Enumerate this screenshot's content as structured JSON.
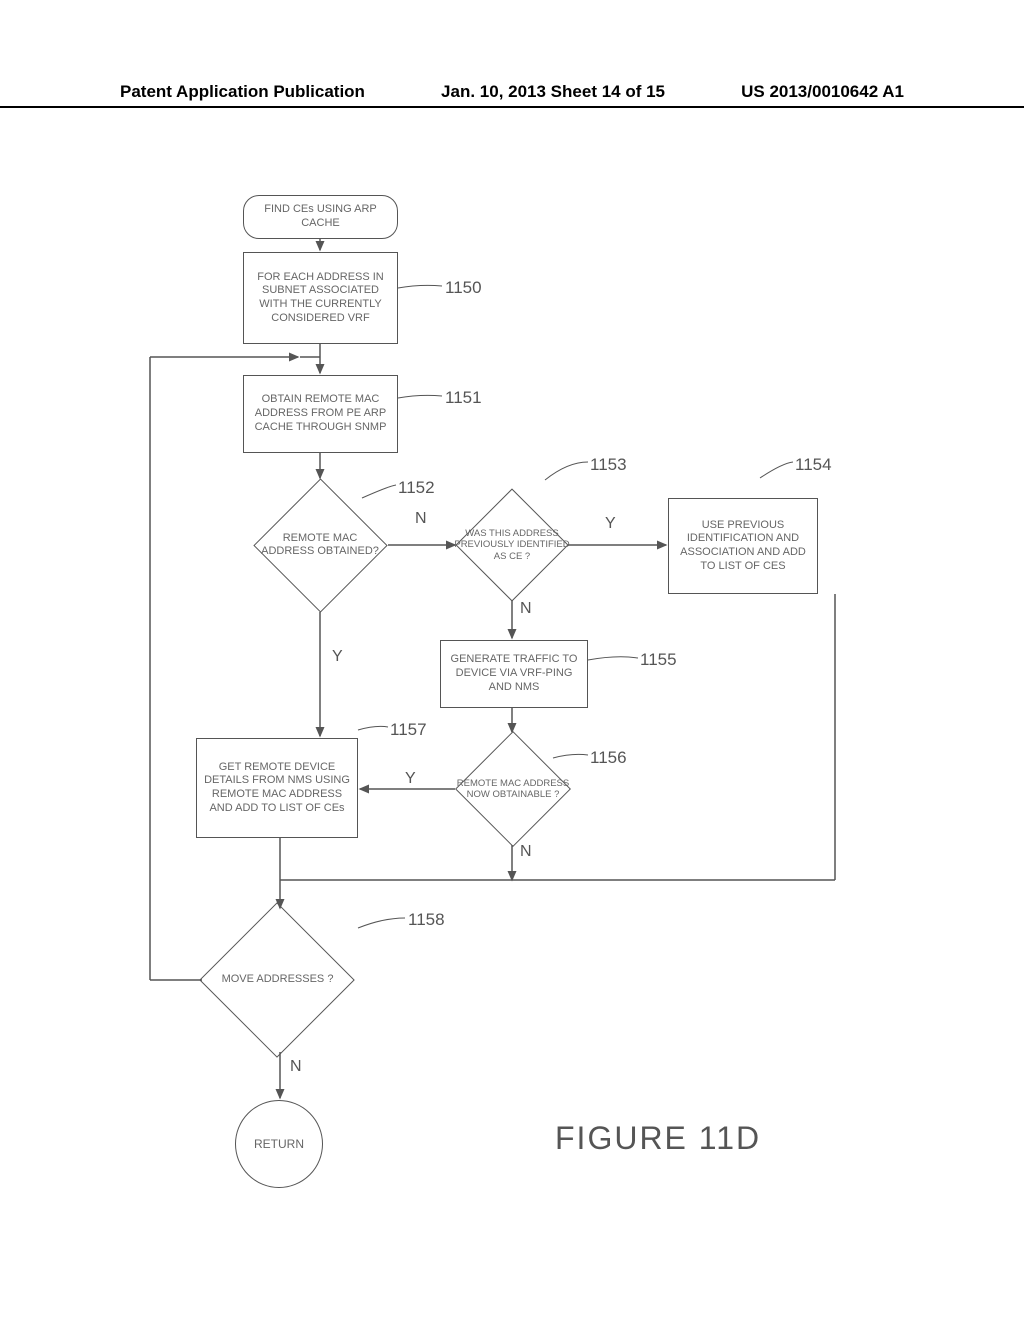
{
  "header": {
    "left": "Patent Application Publication",
    "center": "Jan. 10, 2013  Sheet 14 of 15",
    "right": "US 2013/0010642 A1"
  },
  "start": "FIND CEs USING ARP CACHE",
  "boxes": {
    "b1150": "FOR EACH ADDRESS IN SUBNET ASSOCIATED WITH THE CURRENTLY CONSIDERED VRF",
    "b1151": "OBTAIN REMOTE MAC ADDRESS FROM PE ARP CACHE THROUGH SNMP",
    "b1154": "USE PREVIOUS IDENTIFICATION AND ASSOCIATION AND ADD TO LIST OF CES",
    "b1155": "GENERATE TRAFFIC TO DEVICE VIA VRF-PING AND NMS",
    "b1157": "GET REMOTE DEVICE DETAILS FROM NMS USING REMOTE MAC ADDRESS AND ADD TO LIST OF CEs"
  },
  "diamonds": {
    "d1152": "REMOTE MAC ADDRESS OBTAINED?",
    "d1153": "WAS THIS ADDRESS PREVIOUSLY IDENTIFIED AS CE ?",
    "d1156": "REMOTE MAC ADDRESS NOW OBTAINABLE ?",
    "d1158": "MOVE ADDRESSES ?"
  },
  "return": "RETURN",
  "labels": {
    "l1150": "1150",
    "l1151": "1151",
    "l1152": "1152",
    "l1153": "1153",
    "l1154": "1154",
    "l1155": "1155",
    "l1156": "1156",
    "l1157": "1157",
    "l1158": "1158"
  },
  "yn": {
    "y": "Y",
    "n": "N"
  },
  "figure": "FIGURE 11D"
}
